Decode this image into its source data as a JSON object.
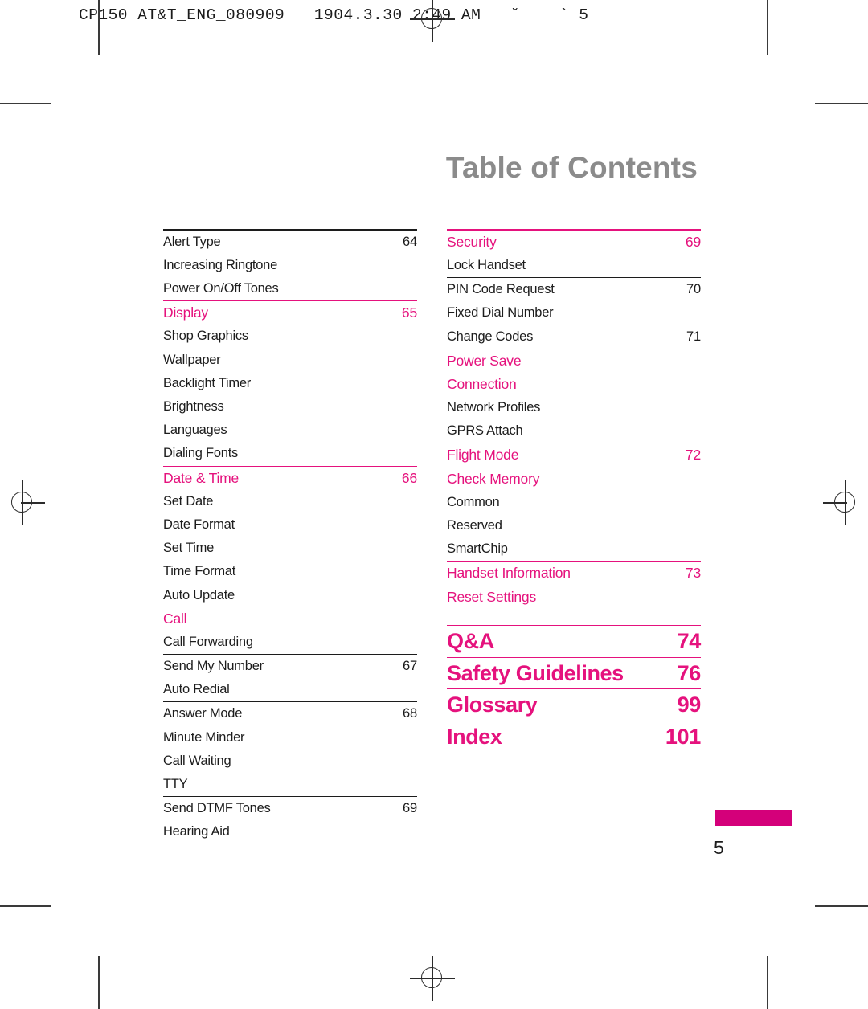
{
  "print_header": "CP150 AT&T_ENG_080909   1904.3.30 2:49 AM   ˘    ` 5",
  "page_title": "Table of Contents",
  "accent_color": "#e5127d",
  "folio_bar_color": "#d4007a",
  "title_color": "#8b8b8b",
  "footer": {
    "page_number": "5"
  },
  "toc": {
    "left_column": [
      {
        "label": "Alert Type",
        "page": "64",
        "style": "normal",
        "rule": "none"
      },
      {
        "label": "Increasing Ringtone",
        "page": "",
        "style": "normal",
        "rule": "none"
      },
      {
        "label": "Power On/Off Tones",
        "page": "",
        "style": "normal",
        "rule": "pink"
      },
      {
        "label": "Display",
        "page": "65",
        "style": "pink",
        "rule": "none"
      },
      {
        "label": "Shop Graphics",
        "page": "",
        "style": "normal",
        "rule": "none"
      },
      {
        "label": "Wallpaper",
        "page": "",
        "style": "normal",
        "rule": "none"
      },
      {
        "label": "Backlight Timer",
        "page": "",
        "style": "normal",
        "rule": "none"
      },
      {
        "label": "Brightness",
        "page": "",
        "style": "normal",
        "rule": "none"
      },
      {
        "label": "Languages",
        "page": "",
        "style": "normal",
        "rule": "none"
      },
      {
        "label": "Dialing Fonts",
        "page": "",
        "style": "normal",
        "rule": "pink"
      },
      {
        "label": "Date & Time",
        "page": "66",
        "style": "pink",
        "rule": "none"
      },
      {
        "label": "Set Date",
        "page": "",
        "style": "normal",
        "rule": "none"
      },
      {
        "label": "Date Format",
        "page": "",
        "style": "normal",
        "rule": "none"
      },
      {
        "label": "Set Time",
        "page": "",
        "style": "normal",
        "rule": "none"
      },
      {
        "label": "Time Format",
        "page": "",
        "style": "normal",
        "rule": "none"
      },
      {
        "label": "Auto Update",
        "page": "",
        "style": "normal",
        "rule": "none"
      },
      {
        "label": "Call",
        "page": "",
        "style": "pink",
        "rule": "none"
      },
      {
        "label": "Call Forwarding",
        "page": "",
        "style": "normal",
        "rule": "black"
      },
      {
        "label": "Send My Number",
        "page": "67",
        "style": "normal",
        "rule": "none"
      },
      {
        "label": "Auto Redial",
        "page": "",
        "style": "normal",
        "rule": "black"
      },
      {
        "label": "Answer Mode",
        "page": "68",
        "style": "normal",
        "rule": "none"
      },
      {
        "label": "Minute Minder",
        "page": "",
        "style": "normal",
        "rule": "none"
      },
      {
        "label": "Call Waiting",
        "page": "",
        "style": "normal",
        "rule": "none"
      },
      {
        "label": "TTY",
        "page": "",
        "style": "normal",
        "rule": "black"
      },
      {
        "label": "Send DTMF Tones",
        "page": "69",
        "style": "normal",
        "rule": "none"
      },
      {
        "label": "Hearing Aid",
        "page": "",
        "style": "normal",
        "rule": "none"
      }
    ],
    "right_column": [
      {
        "label": "Security",
        "page": "69",
        "style": "pink",
        "rule": "none"
      },
      {
        "label": "Lock Handset",
        "page": "",
        "style": "normal",
        "rule": "black"
      },
      {
        "label": "PIN Code Request",
        "page": "70",
        "style": "normal",
        "rule": "none"
      },
      {
        "label": "Fixed Dial Number",
        "page": "",
        "style": "normal",
        "rule": "black"
      },
      {
        "label": "Change Codes",
        "page": "71",
        "style": "normal",
        "rule": "none"
      },
      {
        "label": "Power Save",
        "page": "",
        "style": "pink",
        "rule": "none"
      },
      {
        "label": "Connection",
        "page": "",
        "style": "pink",
        "rule": "none"
      },
      {
        "label": "Network Profiles",
        "page": "",
        "style": "normal",
        "rule": "none"
      },
      {
        "label": "GPRS Attach",
        "page": "",
        "style": "normal",
        "rule": "pink"
      },
      {
        "label": "Flight Mode",
        "page": "72",
        "style": "pink",
        "rule": "none"
      },
      {
        "label": "Check Memory",
        "page": "",
        "style": "pink",
        "rule": "none"
      },
      {
        "label": "Common",
        "page": "",
        "style": "normal",
        "rule": "none"
      },
      {
        "label": "Reserved",
        "page": "",
        "style": "normal",
        "rule": "none"
      },
      {
        "label": "SmartChip",
        "page": "",
        "style": "normal",
        "rule": "pink"
      },
      {
        "label": "Handset Information",
        "page": "73",
        "style": "pink",
        "rule": "none"
      },
      {
        "label": "Reset Settings",
        "page": "",
        "style": "pink",
        "rule": "none"
      }
    ],
    "right_column_major": [
      {
        "label": "Q&A",
        "page": "74"
      },
      {
        "label": "Safety Guidelines",
        "page": "76"
      },
      {
        "label": "Glossary",
        "page": "99"
      },
      {
        "label": "Index",
        "page": "101"
      }
    ]
  }
}
